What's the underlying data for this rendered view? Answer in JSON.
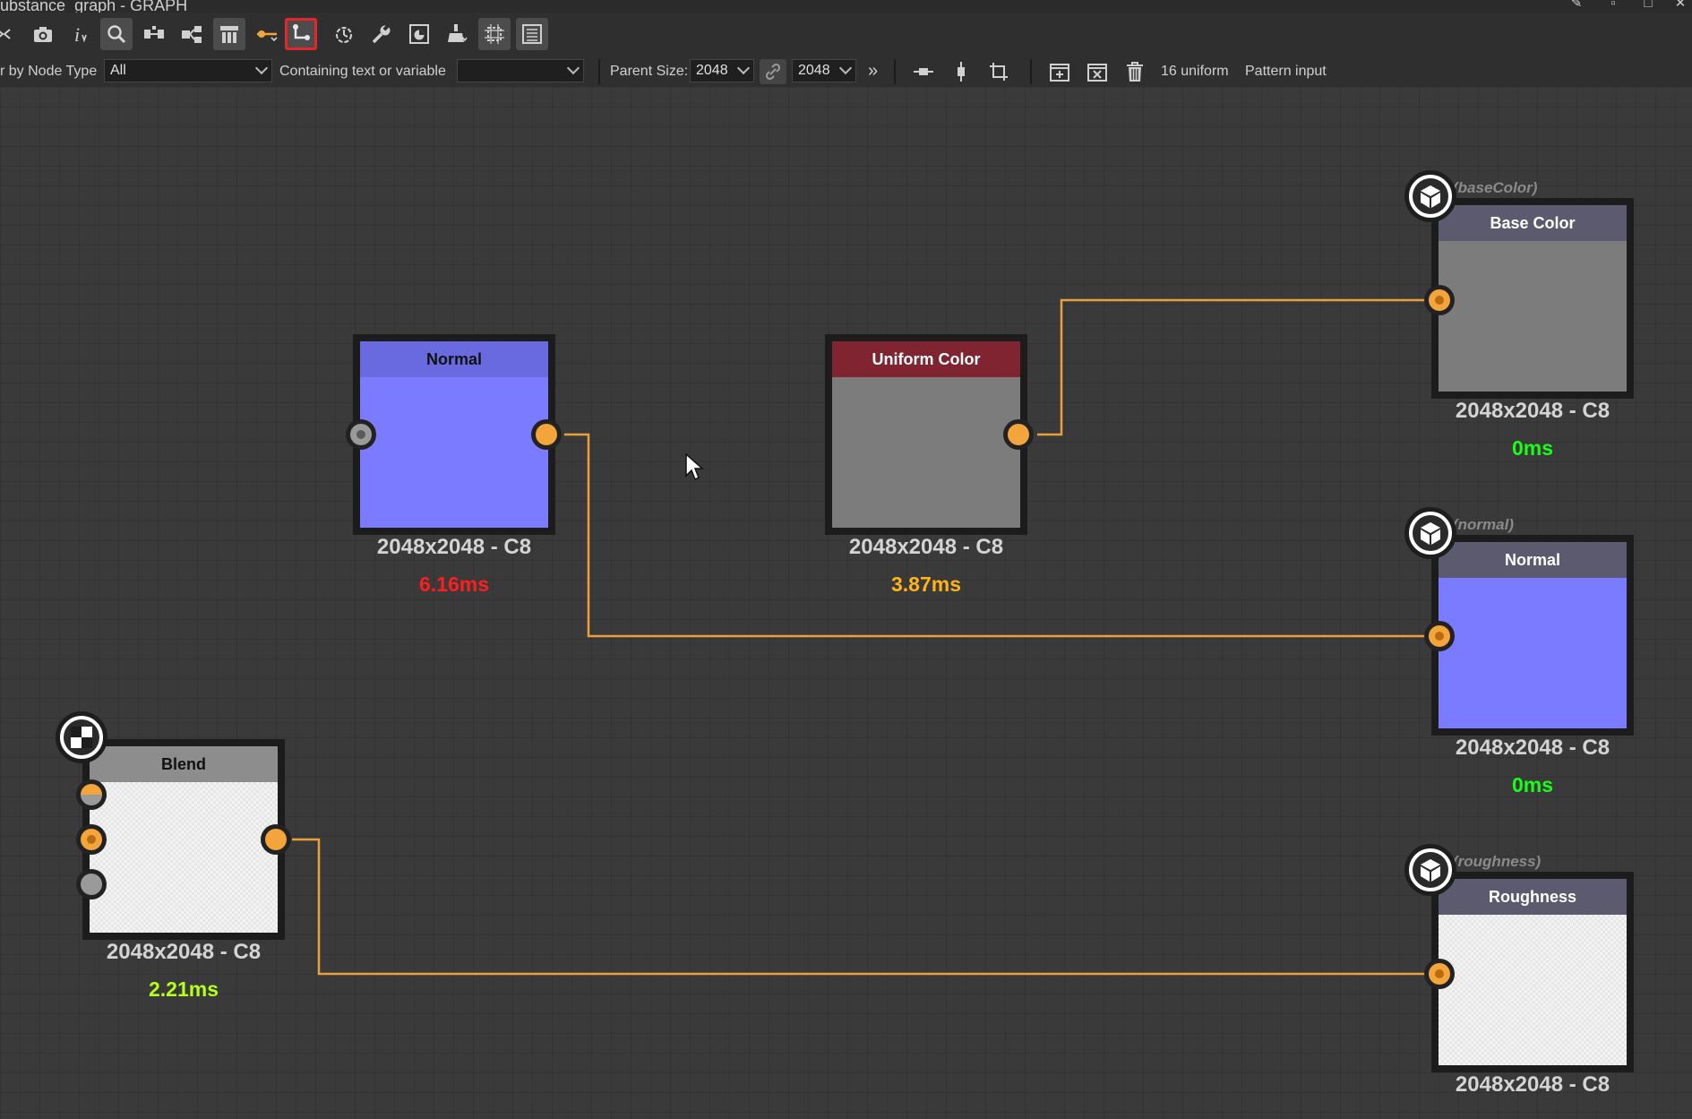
{
  "window": {
    "title": "ubstance_graph - GRAPH"
  },
  "toolbar": {
    "icons": [
      "fit-icon",
      "camera-icon",
      "info-icon",
      "search-icon",
      "hierarchy-icon",
      "share-icon",
      "frame-icon",
      "connector-icon",
      "link-mode-icon",
      "timer-icon",
      "wrench-icon",
      "preview-icon",
      "bake-icon",
      "align-icon",
      "list-icon"
    ]
  },
  "filter_bar": {
    "node_type_label": "r by Node Type",
    "node_type_value": "All",
    "containing_label": "Containing text or variable",
    "containing_value": "",
    "parent_size_label": "Parent Size:",
    "parent_size_w": "2048",
    "parent_size_h": "2048",
    "more_label": "»",
    "uniform_label": "16 uniform",
    "pattern_label": "Pattern input"
  },
  "nodes": {
    "normal_src": {
      "title": "Normal",
      "info": "2048x2048 - C8",
      "time": "6.16ms",
      "color": "#7b7bff",
      "header_color": "#6a6ae0",
      "time_color": "#ff1e1e"
    },
    "uniform": {
      "title": "Uniform Color",
      "info": "2048x2048 - C8",
      "time": "3.87ms",
      "color": "#7c7c7c",
      "header_color": "#7f2430",
      "time_color": "#ffb31a"
    },
    "blend": {
      "title": "Blend",
      "info": "2048x2048 - C8",
      "time": "2.21ms",
      "header_color": "#8d8d8d",
      "time_color": "#b6ff1a"
    },
    "out_basecolor": {
      "identifier": "(baseColor)",
      "title": "Base Color",
      "info": "2048x2048 - C8",
      "time": "0ms",
      "color": "#7c7c7c",
      "header_color": "#5b5a6e",
      "time_color": "#17ff17"
    },
    "out_normal": {
      "identifier": "(normal)",
      "title": "Normal",
      "info": "2048x2048 - C8",
      "time": "0ms",
      "color": "#7b7bff",
      "header_color": "#5b5a6e",
      "time_color": "#17ff17"
    },
    "out_roughness": {
      "identifier": "(roughness)",
      "title": "Roughness",
      "info": "2048x2048 - C8",
      "header_color": "#5b5a6e"
    }
  },
  "colors": {
    "wire": "#e9a13a",
    "canvas": "#3a3a3a",
    "selected_outline": "#e2262a"
  }
}
